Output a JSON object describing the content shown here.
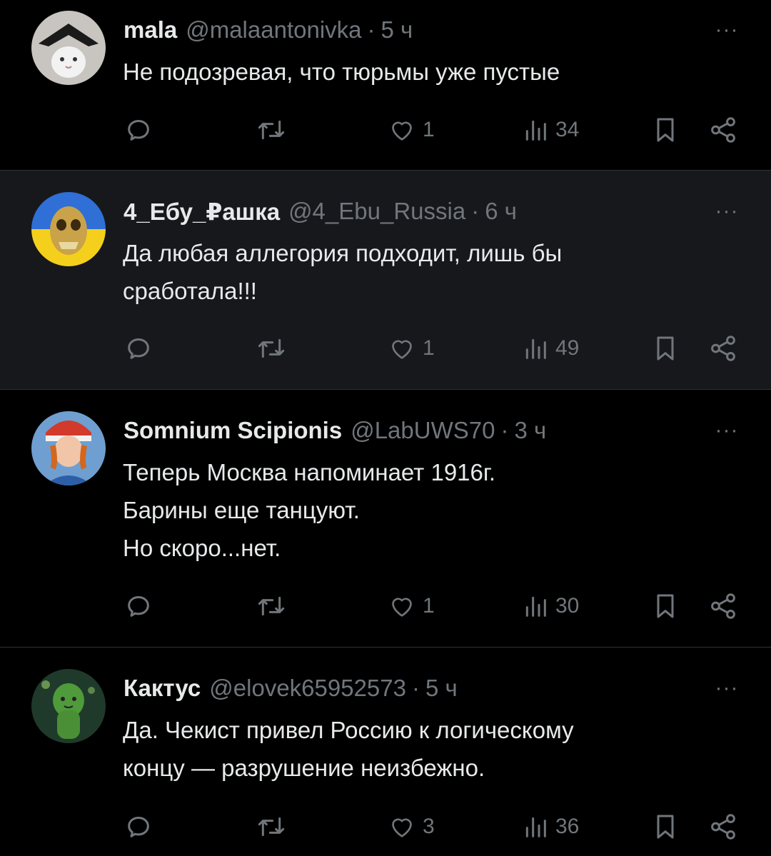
{
  "posts": [
    {
      "name": "mala",
      "handle": "@malaantonivka",
      "separator": "·",
      "time": "5 ч",
      "lines": [
        "Не подозревая, что тюрьмы уже пустые"
      ],
      "likes": "1",
      "views": "34",
      "more_label": "···"
    },
    {
      "name": "4_Ебу_₽ашка",
      "handle": "@4_Ebu_Russia",
      "separator": "·",
      "time": "6 ч",
      "lines": [
        "Да любая аллегория подходит, лишь бы",
        "сработала!!!"
      ],
      "likes": "1",
      "views": "49",
      "more_label": "···"
    },
    {
      "name": "Somnium Scipionis",
      "handle": "@LabUWS70",
      "separator": "·",
      "time": "3 ч",
      "lines": [
        "Теперь Москва напоминает 1916г.",
        "Барины еще танцуют.",
        "Но скоро...нет."
      ],
      "likes": "1",
      "views": "30",
      "more_label": "···"
    },
    {
      "name": "Кактус",
      "handle": "@elovek65952573",
      "separator": "·",
      "time": "5 ч",
      "lines": [
        "Да. Чекист привел Россию к логическому",
        "концу — разрушение неизбежно."
      ],
      "likes": "3",
      "views": "36",
      "more_label": "···"
    }
  ],
  "icons": {
    "reply": "reply-icon",
    "repost": "repost-icon",
    "like": "like-icon",
    "views": "views-icon",
    "bookmark": "bookmark-icon",
    "share": "share-icon",
    "more": "more-icon"
  },
  "colors": {
    "background": "#000000",
    "highlight_background": "#16181c",
    "text": "#e7e9ea",
    "muted": "#71767b",
    "divider": "#2f3336"
  }
}
